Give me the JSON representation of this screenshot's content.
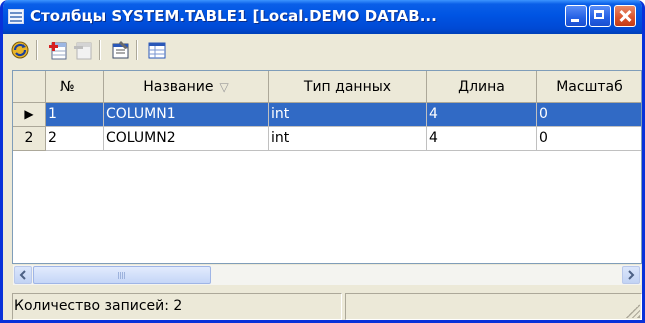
{
  "window": {
    "title": "Столбцы SYSTEM.TABLE1 [Local.DEMO DATAB...",
    "title_icon": "table-icon"
  },
  "toolbar": {
    "icons": [
      "refresh-icon",
      "add-column-icon",
      "delete-column-icon",
      "properties-icon",
      "grid-view-icon"
    ]
  },
  "table": {
    "columns": [
      "№",
      "Название",
      "Тип данных",
      "Длина",
      "Масштаб"
    ],
    "sort_indicator": "▽",
    "rows": [
      {
        "indicator": "▶",
        "no": "1",
        "name": "COLUMN1",
        "type": "int",
        "length": "4",
        "scale": "0",
        "selected": true
      },
      {
        "indicator": "2",
        "no": "2",
        "name": "COLUMN2",
        "type": "int",
        "length": "4",
        "scale": "0",
        "selected": false
      }
    ]
  },
  "statusbar": {
    "records_label": "Количество записей: 2",
    "pane2": ""
  },
  "colors": {
    "selection": "#316ac5",
    "titlebar": "#0054e3"
  }
}
